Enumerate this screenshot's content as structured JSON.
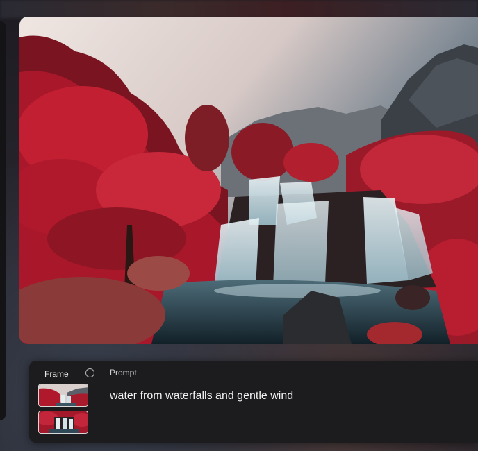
{
  "panel": {
    "frame_label": "Frame",
    "info_icon": "info-icon",
    "info_glyph": "i",
    "prompt_label": "Prompt",
    "prompt_text": "water from waterfalls and gentle wind"
  },
  "preview": {
    "subject": "red-foliage forest waterfall landscape"
  },
  "colors": {
    "panel_bg": "#1c1c1e",
    "thumb_border": "#d8d8d8",
    "text_primary": "#f2f2f2",
    "foliage": "#b21f2e"
  }
}
